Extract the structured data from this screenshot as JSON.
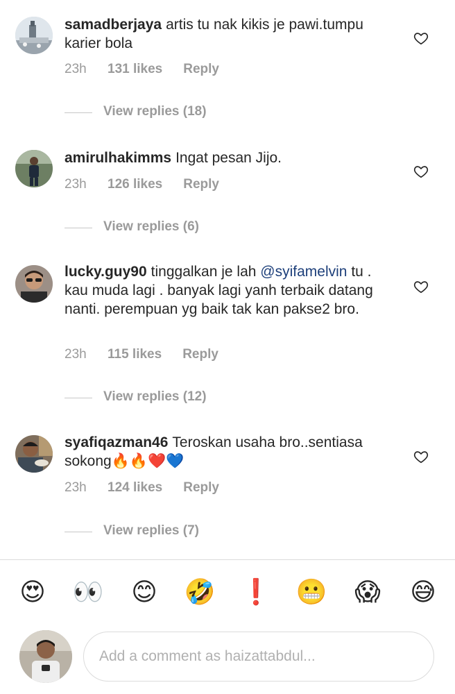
{
  "comments": [
    {
      "username": "samadberjaya",
      "text": "artis tu nak kikis je pawi.tumpu karier bola",
      "time": "23h",
      "likes": "131 likes",
      "reply_label": "Reply",
      "view_replies": "View replies (18)",
      "avatar_icon": "profile-photo-mosque"
    },
    {
      "username": "amirulhakimms",
      "text": "Ingat pesan Jijo.",
      "time": "23h",
      "likes": "126 likes",
      "reply_label": "Reply",
      "view_replies": "View replies (6)",
      "avatar_icon": "profile-photo-person-standing"
    },
    {
      "username": "lucky.guy90",
      "text_before": "tinggalkan je lah ",
      "mention": "@syifamelvin",
      "text_after": " tu . kau muda lagi . banyak lagi yanh terbaik datang nanti. perempuan yg baik tak kan pakse2 bro.",
      "time": "23h",
      "likes": "115 likes",
      "reply_label": "Reply",
      "view_replies": "View replies (12)",
      "avatar_icon": "profile-photo-man-sunglasses"
    },
    {
      "username": "syafiqazman46",
      "text": "Teroskan usaha bro..sentiasa sokong🔥🔥❤️💙",
      "time": "23h",
      "likes": "124 likes",
      "reply_label": "Reply",
      "view_replies": "View replies (7)",
      "avatar_icon": "profile-photo-man-eating"
    }
  ],
  "emoji_bar": [
    "😍",
    "👀",
    "😊",
    "🤣",
    "❗",
    "😬",
    "😱",
    "😅"
  ],
  "composer": {
    "placeholder": "Add a comment as haizattabdul...",
    "value": ""
  },
  "icons": {
    "like": "heart-outline-icon"
  },
  "colors": {
    "text": "#262626",
    "meta": "#9a9a9a",
    "mention": "#1d3f7a",
    "divider": "#dbdbdb"
  }
}
